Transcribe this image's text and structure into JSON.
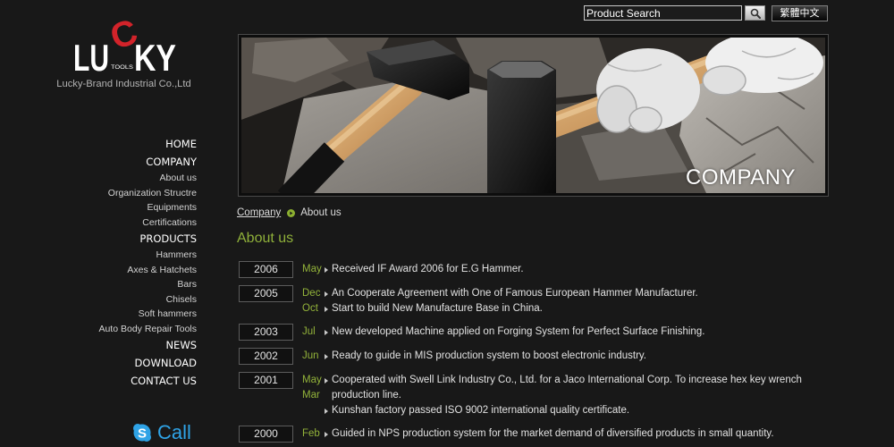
{
  "header": {
    "search": {
      "value": "Product Search",
      "button_icon": "search-icon"
    },
    "language_button": "繁體中文"
  },
  "logo": {
    "letters_left": "LU",
    "letter_c": "C",
    "letters_right": "KY",
    "tools": "TOOLS",
    "company_name": "Lucky-Brand Industrial Co.,Ltd"
  },
  "nav": {
    "home": "HOME",
    "company": {
      "label": "COMPANY",
      "items": [
        "About us",
        "Organization Structre",
        "Equipments",
        "Certifications"
      ]
    },
    "products": {
      "label": "PRODUCTS",
      "items": [
        "Hammers",
        "Axes & Hatchets",
        "Bars",
        "Chisels",
        "Soft hammers",
        "Auto Body Repair Tools"
      ]
    },
    "news": "NEWS",
    "download": "DOWNLOAD",
    "contact": "CONTACT US"
  },
  "skype": {
    "icon": "skype-icon",
    "label": "Call"
  },
  "banner": {
    "caption": "COMPANY"
  },
  "breadcrumb": {
    "parent": "Company",
    "separator_icon": "arrow-circle-icon",
    "current": "About us"
  },
  "page_title": "About us",
  "timeline": [
    {
      "year": "2006",
      "months": [
        "May"
      ],
      "events": [
        "Received IF Award 2006 for E.G Hammer."
      ]
    },
    {
      "year": "2005",
      "months": [
        "Dec",
        "Oct"
      ],
      "events": [
        "An Cooperate Agreement with One of Famous European Hammer Manufacturer.",
        "Start to build New Manufacture Base in China."
      ]
    },
    {
      "year": "2003",
      "months": [
        "Jul"
      ],
      "events": [
        "New developed Machine applied on Forging System for Perfect Surface Finishing."
      ]
    },
    {
      "year": "2002",
      "months": [
        "Jun"
      ],
      "events": [
        "Ready to guide in MIS production system to boost electronic industry."
      ]
    },
    {
      "year": "2001",
      "months": [
        "May",
        "Mar"
      ],
      "events": [
        "Cooperated with Swell Link Industry Co., Ltd. for a Jaco International Corp. To increase hex key wrench production line.",
        "Kunshan factory passed ISO 9002 international quality certificate."
      ]
    },
    {
      "year": "2000",
      "months": [
        "Feb"
      ],
      "events": [
        "Guided in NPS production system for the market demand of diversified products in small quantity."
      ]
    }
  ],
  "colors": {
    "background": "#181818",
    "accent_green": "#8fb03a",
    "logo_red": "#d2232a",
    "skype_blue": "#2fa3e6"
  }
}
